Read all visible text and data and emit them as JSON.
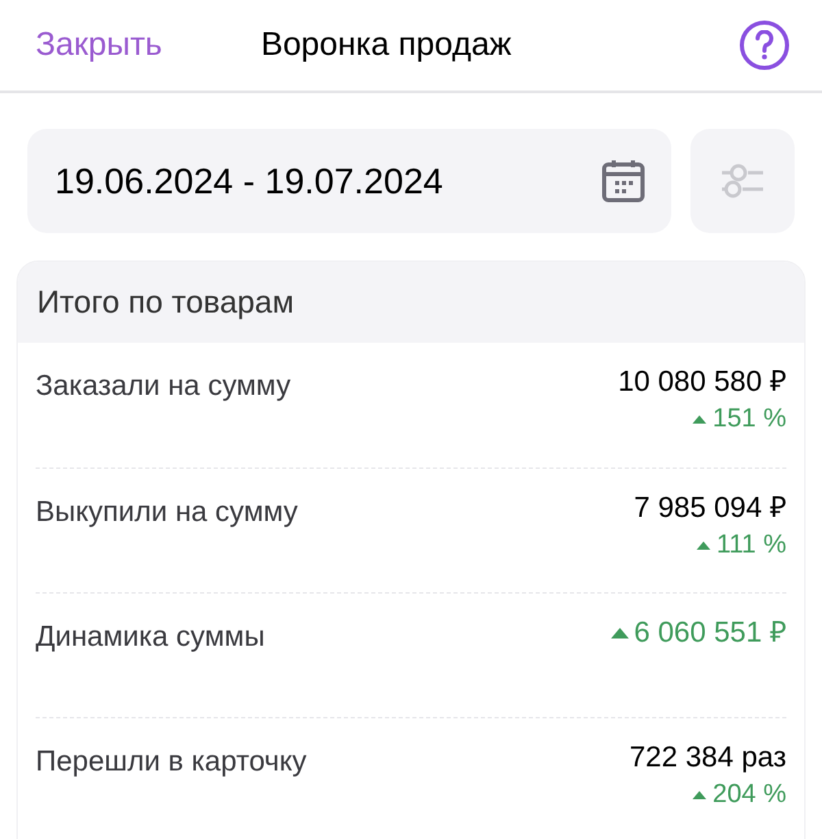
{
  "header": {
    "close": "Закрыть",
    "title": "Воронка продаж"
  },
  "period": {
    "value": "19.06.2024 - 19.07.2024"
  },
  "summary": {
    "title": "Итого по товарам",
    "rows": [
      {
        "label": "Заказали на сумму",
        "value": "10 080 580 ₽",
        "value_up": false,
        "change": "151 %",
        "change_up": true
      },
      {
        "label": "Выкупили на сумму",
        "value": "7 985 094 ₽",
        "value_up": false,
        "change": "111 %",
        "change_up": true
      },
      {
        "label": "Динамика суммы",
        "value": "6 060 551 ₽",
        "value_up": true
      },
      {
        "label": "Перешли в карточку",
        "value": "722 384 раз",
        "value_up": false,
        "change": "204 %",
        "change_up": true
      }
    ]
  }
}
